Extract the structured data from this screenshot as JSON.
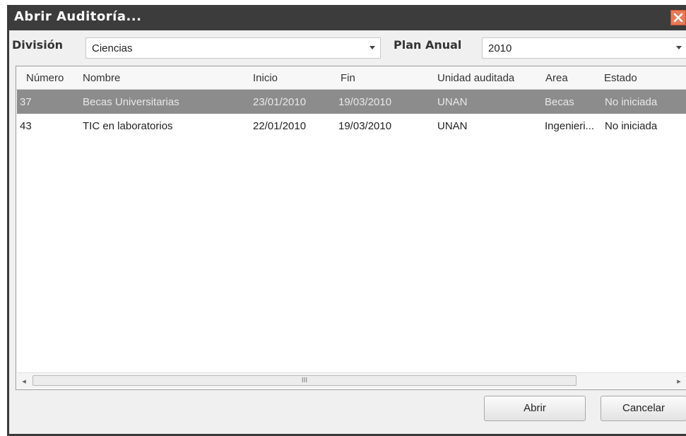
{
  "window": {
    "title": "Abrir Auditoría..."
  },
  "filters": {
    "division_label": "División",
    "division_value": "Ciencias",
    "plan_label": "Plan Anual",
    "plan_value": "2010"
  },
  "table": {
    "columns": [
      "Número",
      "Nombre",
      "Inicio",
      "Fin",
      "Unidad auditada",
      "Area",
      "Estado"
    ],
    "rows": [
      {
        "selected": true,
        "cells": [
          "37",
          "Becas Universitarias",
          "23/01/2010",
          "19/03/2010",
          "UNAN",
          "Becas",
          "No iniciada"
        ]
      },
      {
        "selected": false,
        "cells": [
          "43",
          "TIC en laboratorios",
          "22/01/2010",
          "19/03/2010",
          "UNAN",
          "Ingenieri...",
          "No iniciada"
        ]
      }
    ],
    "scrollbar": {
      "left_arrow": "◂",
      "thumb_grip": "III",
      "right_arrow": "▸"
    }
  },
  "buttons": {
    "open_label": "Abrir",
    "cancel_label": "Cancelar"
  },
  "colors": {
    "titlebar": "#3c3c3c",
    "selected_row": "#8c8c8c",
    "close": "#e87a58"
  }
}
